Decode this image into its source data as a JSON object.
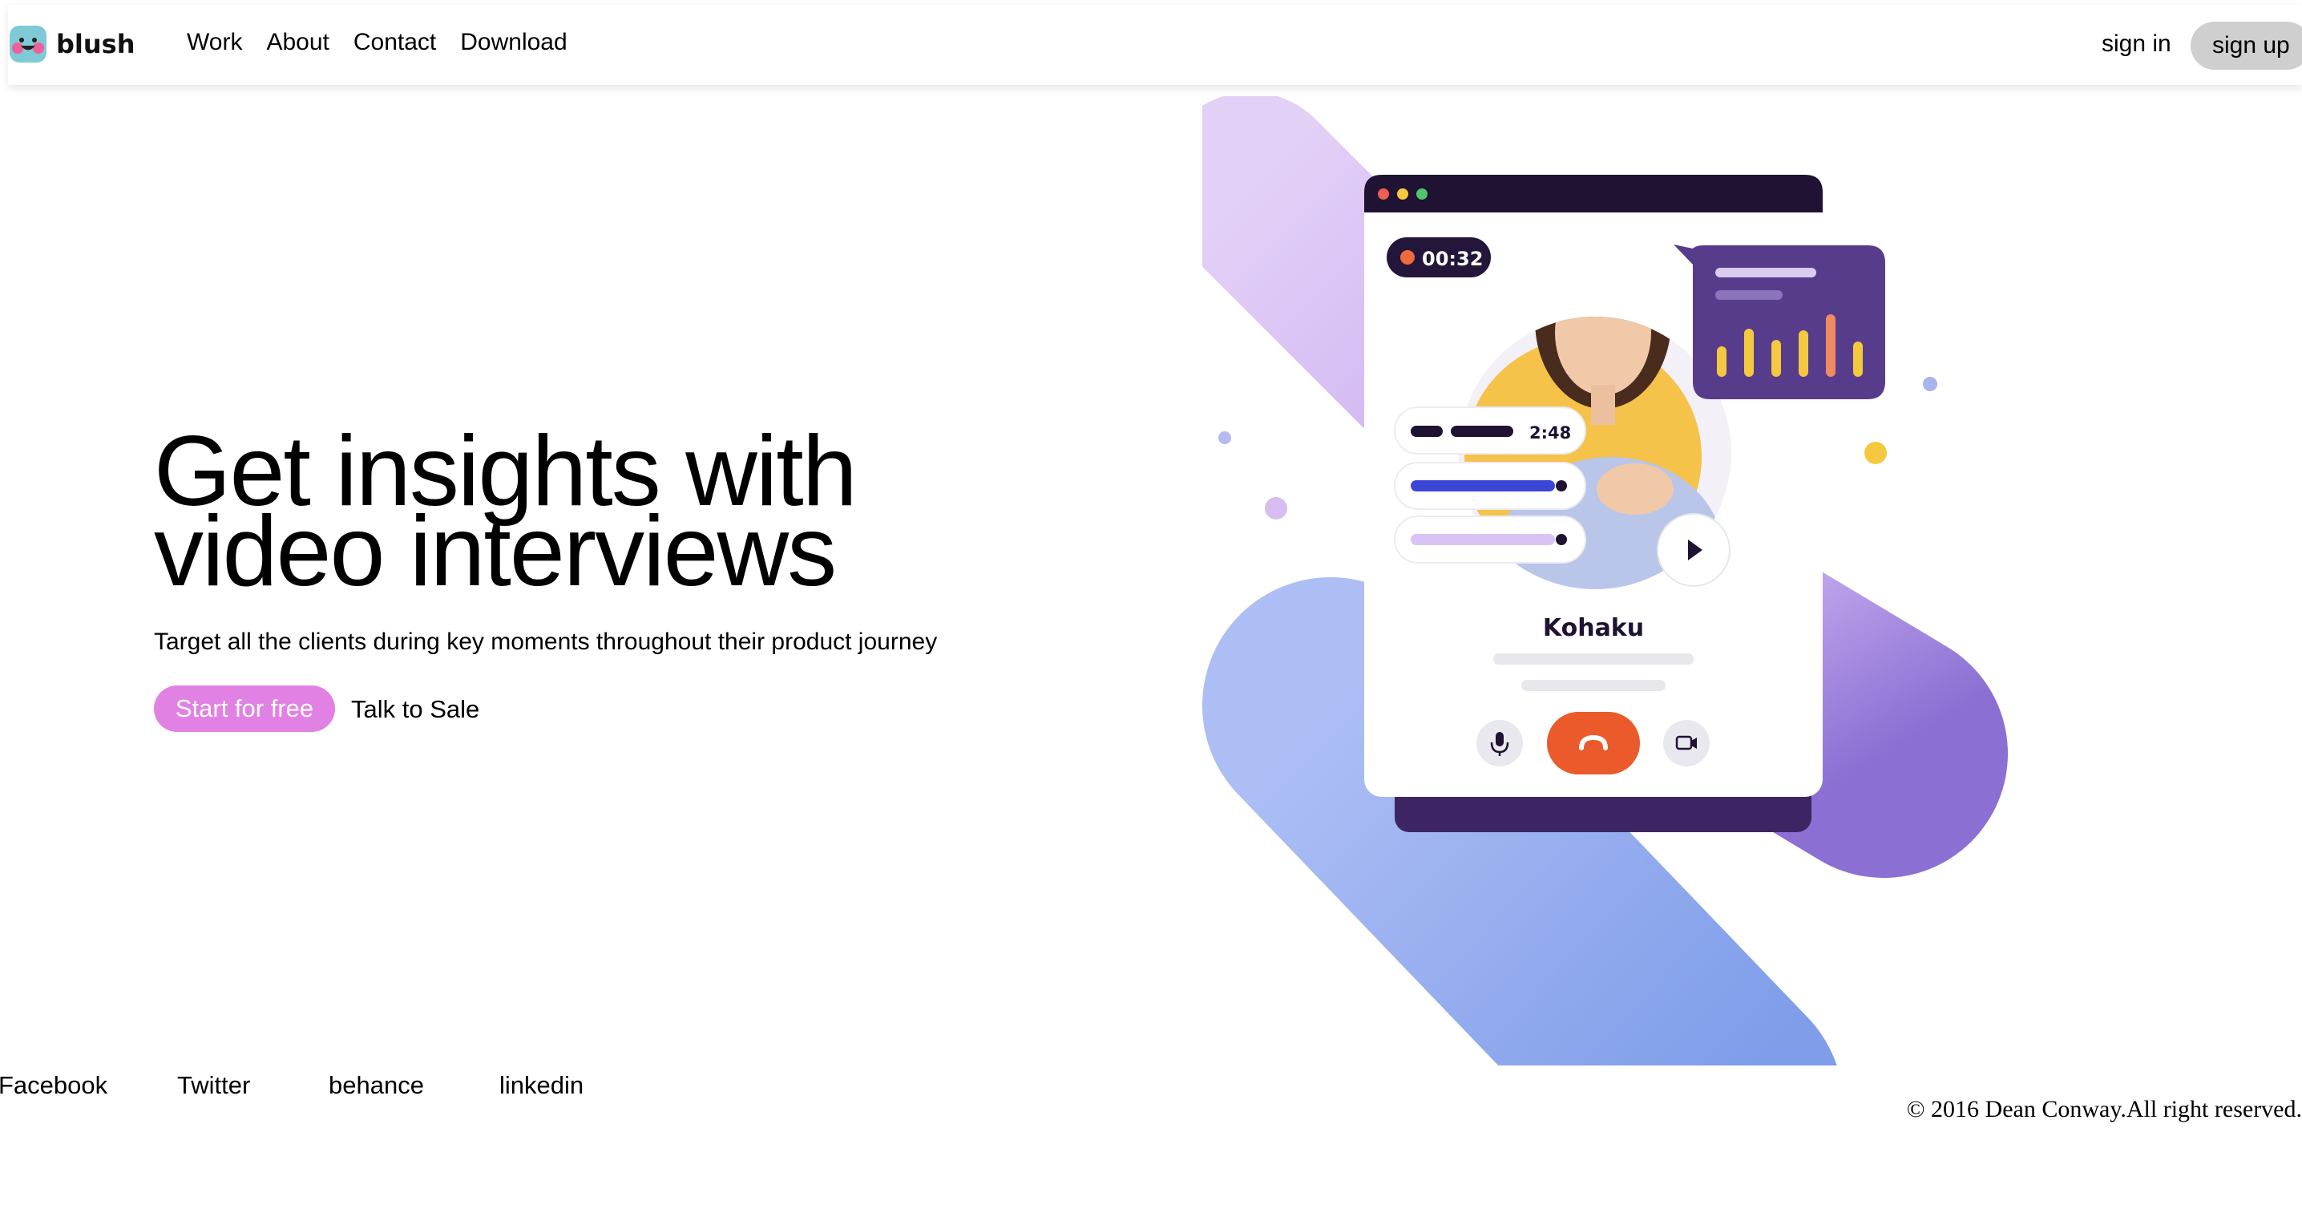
{
  "header": {
    "brand": "blush",
    "nav": [
      "Work",
      "About",
      "Contact",
      "Download"
    ],
    "sign_in": "sign in",
    "sign_up": "sign up"
  },
  "hero": {
    "title_line1": "Get insights with",
    "title_line2": "video interviews",
    "subtitle": "Target all the clients during key moments throughout their product journey",
    "cta_primary": "Start for free",
    "cta_secondary": "Talk to Sale"
  },
  "illustration": {
    "timer": "00:32",
    "track_time": "2:48",
    "name": "Kohaku",
    "icons": [
      "microphone-icon",
      "end-call-icon",
      "camera-icon",
      "play-icon"
    ]
  },
  "footer": {
    "social": [
      "Facebook",
      "Twitter",
      "behance",
      "linkedin"
    ],
    "copyright": "© 2016 Dean Conway.All right reserved."
  },
  "colors": {
    "primary_button": "#e281e4",
    "sign_up_bg": "#cfcfcf",
    "call_end": "#ea5a2b",
    "window_dark": "#1f1232",
    "purple": "#5b3a8a",
    "blue": "#8ea6ee"
  }
}
